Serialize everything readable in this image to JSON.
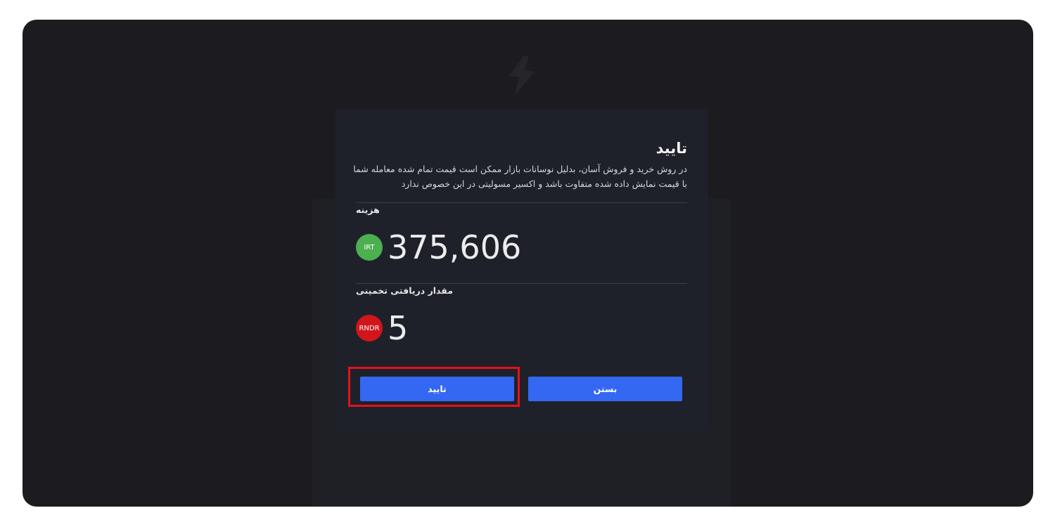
{
  "modal": {
    "title": "تایید",
    "description": "در روش خرید و فروش آسان، بدلیل نوسانات بازار ممکن است قیمت تمام شده معامله شما با قیمت نمایش داده شده متفاوت باشد و اکسیر مسولیتی در این خصوص ندارد",
    "cost": {
      "label": "هزینه",
      "value": "375,606",
      "currency": "IRT",
      "currency_color": "#4caf50"
    },
    "estimate": {
      "label": "مقدار دریافتی تخمینی",
      "value": "5",
      "currency": "RNDR",
      "currency_color": "#d0161b"
    },
    "confirm_label": "تایید",
    "close_label": "بستن"
  },
  "colors": {
    "background": "#1c1c20",
    "modal": "#1f212a",
    "accent": "#3468f2",
    "highlight": "#e4121b"
  }
}
